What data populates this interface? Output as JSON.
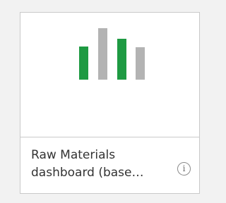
{
  "tile": {
    "title_line1": "Raw Materials",
    "title_line2": "dashboard (base…",
    "info_icon_glyph": "i",
    "thumbnail_icon": "bar-chart-icon"
  },
  "colors": {
    "accent_green": "#1e9a42",
    "neutral_gray": "#b3b3b3",
    "page_background": "#f2f2f2",
    "tile_border": "#c9c9c9"
  }
}
